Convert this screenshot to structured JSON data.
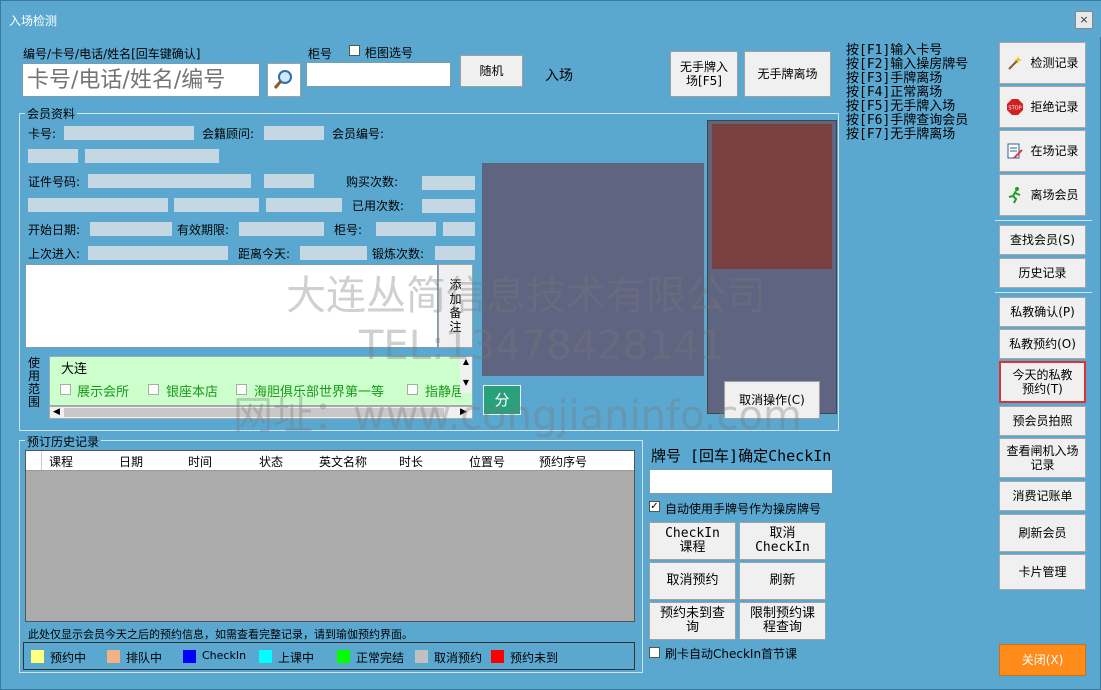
{
  "window": {
    "title": "入场检测",
    "close_glyph": "×"
  },
  "search": {
    "label": "编号/卡号/电话/姓名[回车键确认]",
    "placeholder": "卡号/电话/姓名/编号",
    "cabinet_label": "柜号",
    "cabinet_select_label": "柜图选号",
    "random_button": "随机",
    "entry_label": "入场",
    "no_plate_entry_button": "无手牌入场[F5]",
    "no_plate_exit_button": "无手牌离场"
  },
  "hotkeys": [
    "按[F1]输入卡号",
    "按[F2]输入操房牌号",
    "按[F3]手牌离场",
    "按[F4]正常离场",
    "按[F5]无手牌入场",
    "按[F6]手牌查询会员",
    "按[F7]无手牌离场"
  ],
  "member": {
    "section_title": "会员资料",
    "card_no_label": "卡号:",
    "consultant_label": "会籍顾问:",
    "member_no_label": "会员编号:",
    "id_no_label": "证件号码:",
    "purchase_count_label": "购买次数:",
    "used_count_label": "已用次数:",
    "start_date_label": "开始日期:",
    "valid_until_label": "有效期限:",
    "cabinet_label": "柜号:",
    "last_entry_label": "上次进入:",
    "days_ago_label": "距离今天:",
    "workout_count_label": "锻炼次数:",
    "add_note_button": "添加备注",
    "scope_label": "使用范围",
    "scope_city": "大连",
    "scope_options": [
      "展示会所",
      "银座本店",
      "海胆俱乐部世界第一等",
      "指静居"
    ],
    "split_button": "分",
    "cancel_button": "取消操作(C)"
  },
  "history": {
    "section_title": "预订历史记录",
    "columns": [
      "课程",
      "日期",
      "时间",
      "状态",
      "英文名称",
      "时长",
      "位置号",
      "预约序号"
    ],
    "note": "此处仅显示会员今天之后的预约信息，如需查看完整记录，请到瑜伽预约界面。",
    "legend": [
      {
        "label": "预约中",
        "color": "#ffff80"
      },
      {
        "label": "排队中",
        "color": "#f4b183"
      },
      {
        "label": "CheckIn",
        "color": "#0000ff"
      },
      {
        "label": "上课中",
        "color": "#00ffff"
      },
      {
        "label": "正常完结",
        "color": "#00ff00"
      },
      {
        "label": "取消预约",
        "color": "#c0c0c0"
      },
      {
        "label": "预约未到",
        "color": "#ff0000"
      }
    ]
  },
  "checkin": {
    "title": "牌号 [回车]确定CheckIn",
    "auto_plate_label": "自动使用手牌号作为操房牌号",
    "auto_checkin_label": "刷卡自动CheckIn首节课",
    "buttons": [
      "CheckIn课程",
      "取消CheckIn",
      "取消预约",
      "刷新",
      "预约未到查询",
      "限制预约课程查询"
    ]
  },
  "sidebar": {
    "buttons": [
      "检测记录",
      "拒绝记录",
      "在场记录",
      "离场会员",
      "查找会员(S)",
      "历史记录",
      "私教确认(P)",
      "私教预约(O)",
      "今天的私教预约(T)",
      "预会员拍照",
      "查看闸机入场记录",
      "消费记账单",
      "刷新会员",
      "卡片管理"
    ],
    "close_button": "关闭(X)"
  },
  "watermark": {
    "line1": "大连丛简信息技术有限公司",
    "line2": "TEL:13478428141",
    "line3": "网址：www.congjianinfo.com"
  },
  "colors": {
    "background": "#5aa8d0",
    "photo_panel": "#5f6480",
    "photo_side": "#7a3f3f",
    "close_button": "#ff8c1a",
    "scope_bg": "#ccffcc",
    "highlight_border": "#e03030"
  }
}
